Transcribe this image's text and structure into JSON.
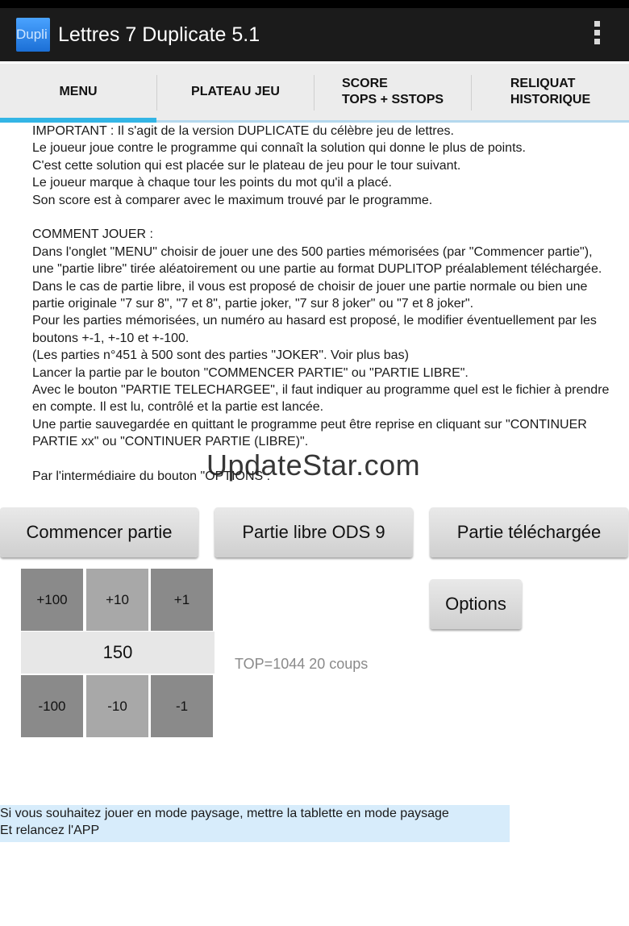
{
  "app": {
    "icon_text": "Dupli",
    "title": "Lettres 7 Duplicate 5.1"
  },
  "tabs": [
    {
      "line1": "MENU",
      "line2": ""
    },
    {
      "line1": "PLATEAU JEU",
      "line2": ""
    },
    {
      "line1": "SCORE",
      "line2": "TOPS + SSTOPS"
    },
    {
      "line1": "RELIQUAT",
      "line2": "HISTORIQUE"
    }
  ],
  "content": {
    "p1": "IMPORTANT : Il s'agit de la version DUPLICATE du célèbre jeu de lettres.",
    "p2": "Le joueur joue contre le programme qui connaît la solution qui donne le plus de points.",
    "p3": "C'est cette solution qui est placée sur le plateau de jeu pour le tour suivant.",
    "p4": "Le joueur marque à chaque tour les points du mot qu'il a placé.",
    "p5": "Son score est à comparer avec le maximum trouvé par le programme.",
    "p6": "COMMENT JOUER :",
    "p7": "Dans l'onglet \"MENU\" choisir de jouer une des 500 parties mémorisées (par \"Commencer partie\"), une \"partie libre\" tirée aléatoirement ou une partie au format DUPLITOP préalablement téléchargée.",
    "p8": "Dans le cas de partie libre, il vous est proposé de choisir de jouer une partie normale ou bien une partie originale \"7 sur 8\", \"7 et 8\", partie joker, \"7 sur 8 joker\" ou \"7 et 8 joker\".",
    "p9": "Pour les parties mémorisées, un numéro au hasard est proposé, le modifier éventuellement par les boutons +-1, +-10 et +-100.",
    "p10": "(Les parties n°451 à 500 sont des parties \"JOKER\". Voir plus bas)",
    "p11": "Lancer la partie par le bouton \"COMMENCER PARTIE\" ou \"PARTIE LIBRE\".",
    "p12": "Avec le bouton \"PARTIE TELECHARGEE\", il faut indiquer au programme quel est le fichier à prendre en compte. Il est lu, contrôlé et la partie est lancée.",
    "p13": "Une partie sauvegardée en quittant le programme peut être reprise en cliquant sur \"CONTINUER PARTIE xx\" ou \"CONTINUER PARTIE (LIBRE)\".",
    "p14": "Par l'intermédiaire du bouton \"OPTIONS :"
  },
  "watermark": "UpdateStar.com",
  "buttons": {
    "start": "Commencer partie",
    "free": "Partie libre ODS 9",
    "downloaded": "Partie téléchargée",
    "options": "Options"
  },
  "stepper": {
    "plus100": "+100",
    "plus10": "+10",
    "plus1": "+1",
    "value": "150",
    "minus100": "-100",
    "minus10": "-10",
    "minus1": "-1"
  },
  "top_info": "TOP=1044  20 coups",
  "notice": {
    "line1": "Si vous souhaitez jouer en mode paysage, mettre la tablette en mode paysage",
    "line2": "Et relancez l'APP"
  }
}
